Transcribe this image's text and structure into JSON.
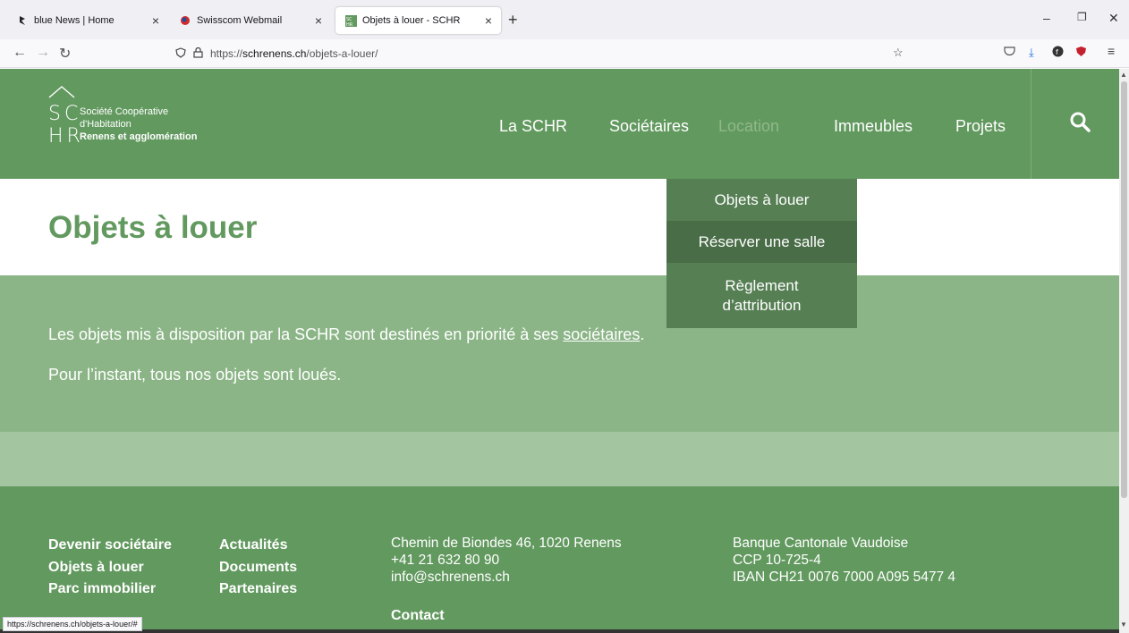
{
  "browser": {
    "tabs": [
      {
        "title": "blue News | Home",
        "icon": "bluenews-icon"
      },
      {
        "title": "Swisscom Webmail",
        "icon": "swisscom-icon"
      },
      {
        "title": "Objets à louer - SCHR",
        "icon": "schr-icon"
      }
    ],
    "url_prefix": "https://",
    "url_domain": "schrenens.ch",
    "url_path": "/objets-a-louer/",
    "status_url": "https://schrenens.ch/objets-a-louer/#"
  },
  "site": {
    "logo_letters_top": "SC",
    "logo_letters_bottom": "HR",
    "logo_line1": "Société Coopérative",
    "logo_line2": "d'Habitation",
    "logo_line3": "Renens et agglomération",
    "nav": [
      "La SCHR",
      "Sociétaires",
      "Location",
      "Immeubles",
      "Projets"
    ],
    "dropdown": [
      "Objets à louer",
      "Réserver une salle",
      "Règlement",
      "d’attribution"
    ],
    "page_title": "Objets à louer",
    "para1_start": "Les objets mis à disposition par la SCHR sont destinés en priorité à ses ",
    "para1_link": "sociétaires",
    "para1_end": ".",
    "para2": "Pour l’instant, tous nos objets sont loués.",
    "footer": {
      "col1": [
        "Devenir sociétaire",
        "Objets à louer",
        "Parc immobilier"
      ],
      "col2": [
        "Actualités",
        "Documents",
        "Partenaires"
      ],
      "col3": [
        "Chemin de Biondes 46, 1020 Renens",
        "+41 21 632 80 90",
        "info@schrenens.ch"
      ],
      "contact": "Contact",
      "col4": [
        "Banque Cantonale Vaudoise",
        "CCP 10-725-4",
        "IBAN CH21 0076 7000 A095 5477 4"
      ]
    }
  },
  "colors": {
    "header_green": "#62995f",
    "dropdown_green": "#567f54",
    "content_green": "#8bb587",
    "band_green": "#a3c5a0"
  }
}
